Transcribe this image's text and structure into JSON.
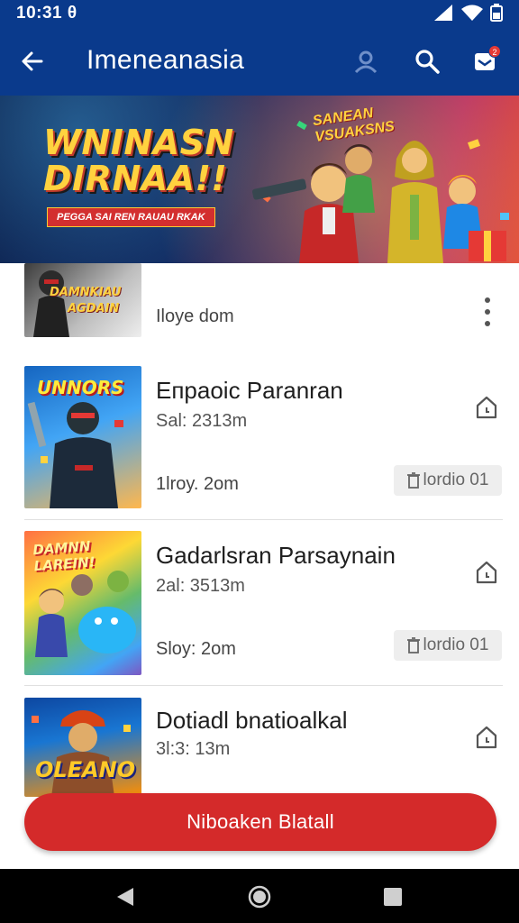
{
  "status_bar": {
    "time": "10:31",
    "time_suffix": "θ"
  },
  "app_bar": {
    "title": "Imeneanasia",
    "icons": [
      "back-arrow-icon",
      "profile-icon",
      "search-icon",
      "inbox-icon"
    ],
    "badge_count": "2"
  },
  "banner": {
    "headline_line1": "WNINASN",
    "headline_line2": "DIRNAA!!",
    "subline": "PEGGA SAI REN RAUAU RKAK",
    "tagline_line1": "SANEAN",
    "tagline_line2": "VSUAKSNS"
  },
  "list": {
    "partial_item": {
      "thumb_line1": "DAMNKIAU",
      "thumb_line2": "AGDAIN",
      "players": "Iloye dom"
    },
    "items": [
      {
        "thumb_text": "UNNORS",
        "name": "Eпpaoic Paranran",
        "meta": "Sal: 2313m",
        "players": "1lroy. 2om",
        "chip": "lordio 01"
      },
      {
        "thumb_text": "DAMNN LAREIN!",
        "name": "Gadarlsran Parsaynain",
        "meta": "2al: 3513m",
        "players": "Sloy: 2om",
        "chip": "lordio 01"
      },
      {
        "thumb_text": "OLEANO",
        "name": "Dotiadl bnatioalkal",
        "meta": "3l:3: 13m",
        "players": "",
        "chip": ""
      }
    ]
  },
  "cta": {
    "label": "Niboaken Blatall"
  },
  "colors": {
    "app_bar": "#0a3a8c",
    "accent_red": "#d42a2a",
    "badge": "#e53935"
  }
}
